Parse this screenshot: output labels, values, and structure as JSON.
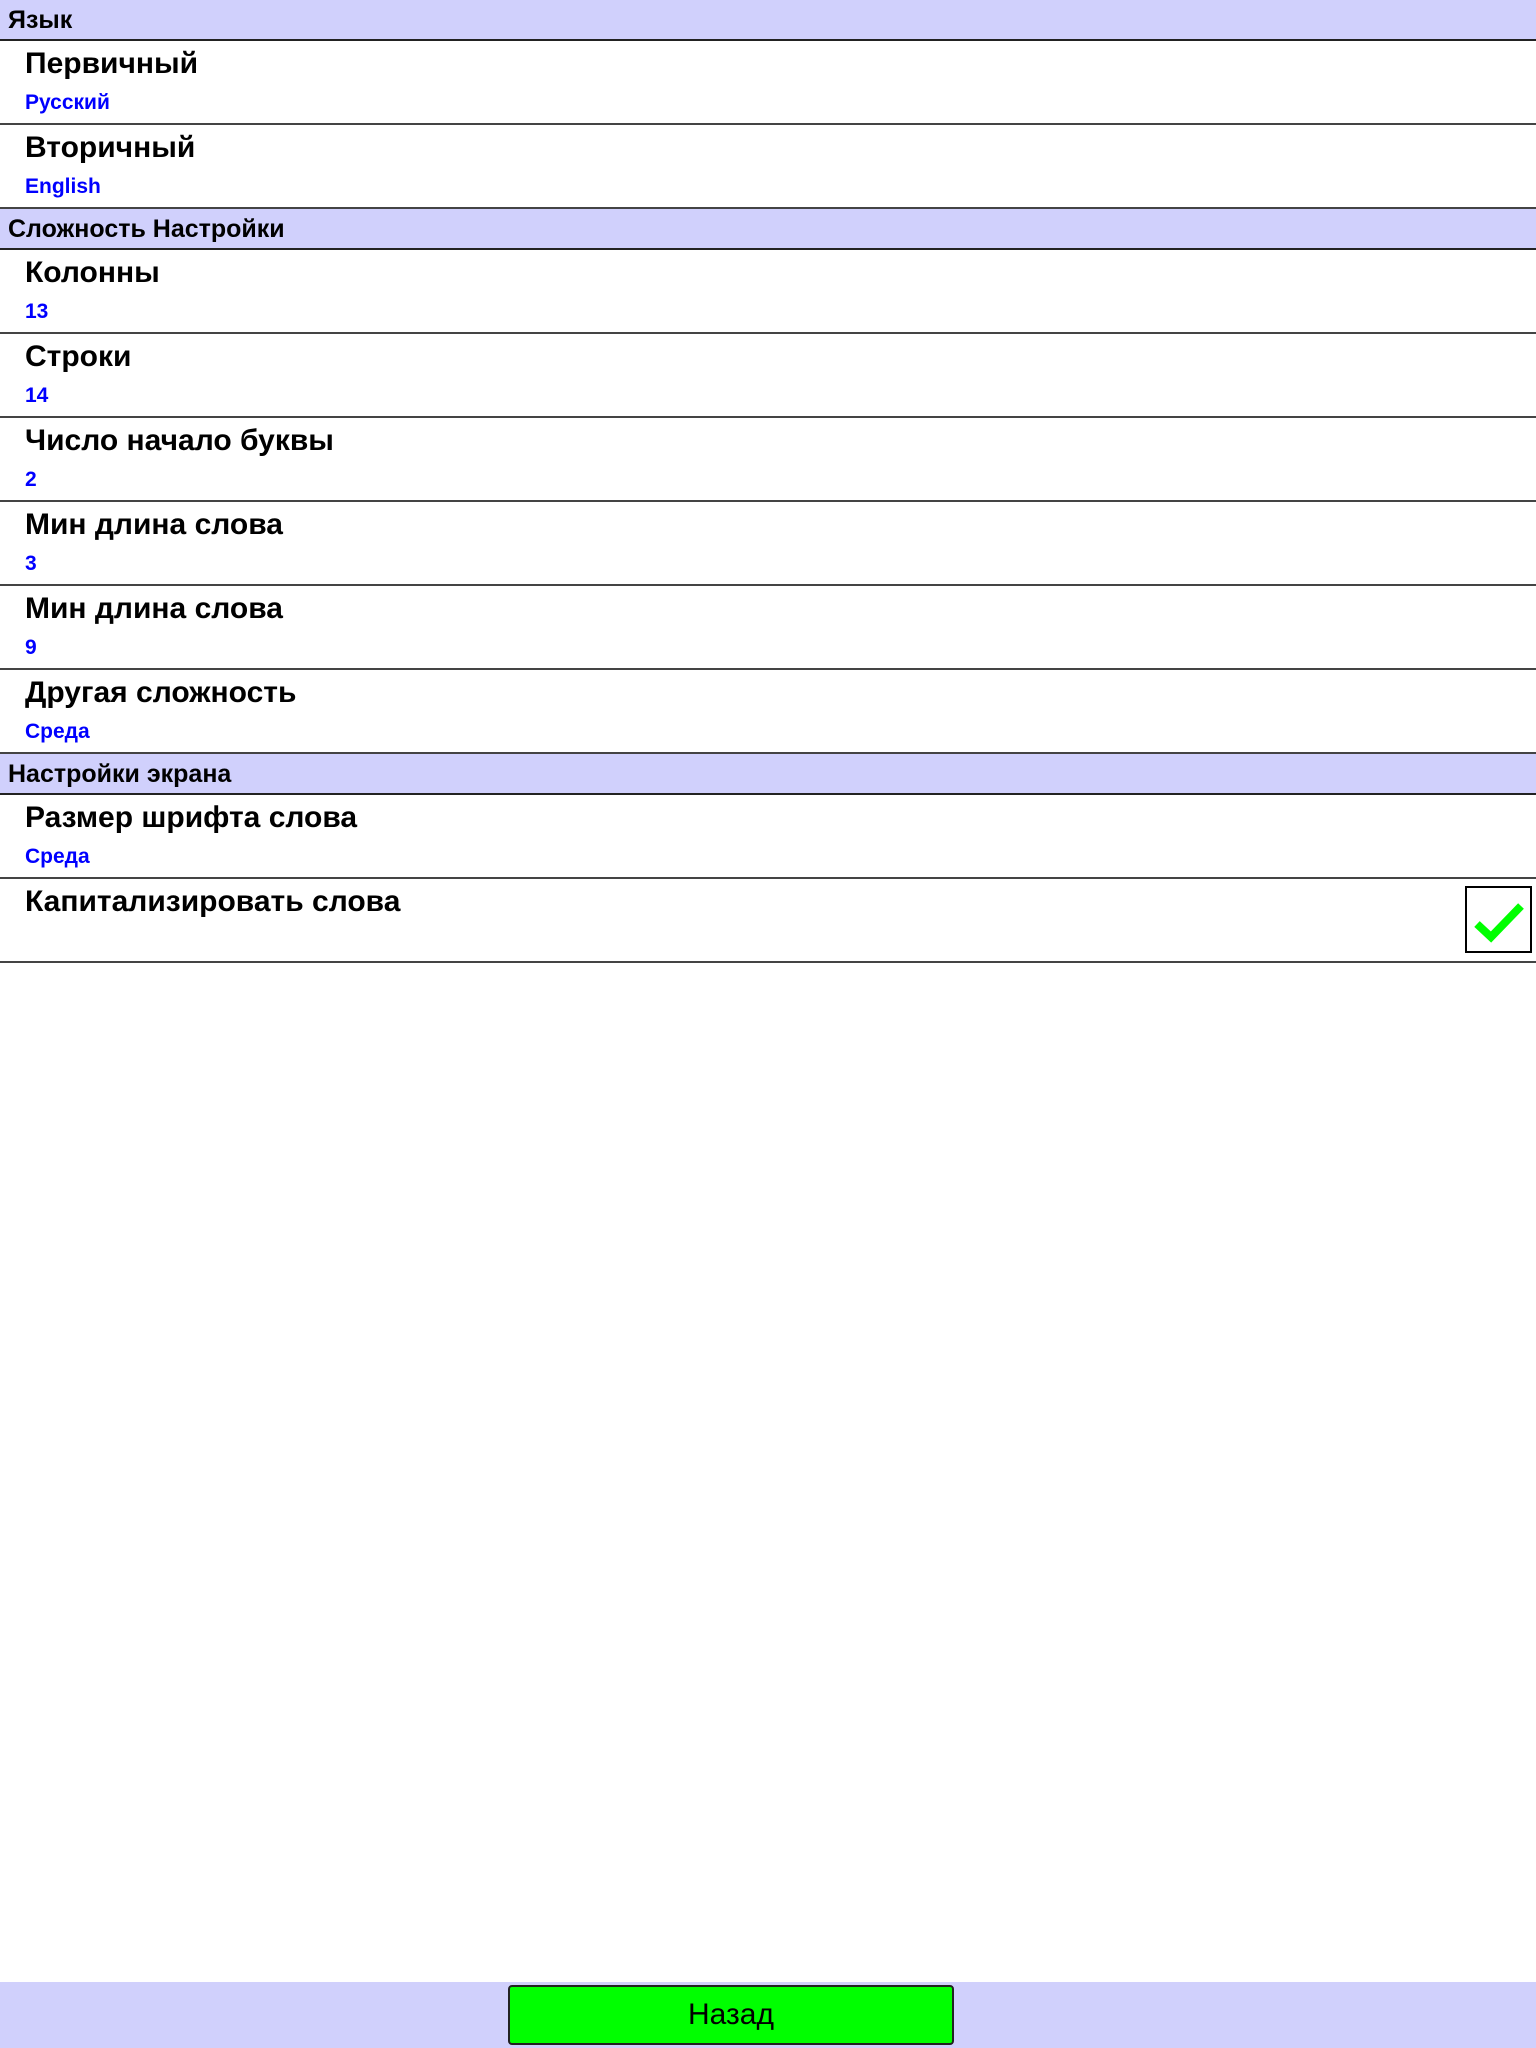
{
  "sections": [
    {
      "header": "Язык",
      "items": [
        {
          "title": "Первичный",
          "value": "Русский"
        },
        {
          "title": "Вторичный",
          "value": "English"
        }
      ]
    },
    {
      "header": "Сложность Настройки",
      "items": [
        {
          "title": "Колонны",
          "value": "13"
        },
        {
          "title": "Строки",
          "value": "14"
        },
        {
          "title": "Число начало буквы",
          "value": "2"
        },
        {
          "title": "Мин длина слова",
          "value": "3"
        },
        {
          "title": "Мин длина слова",
          "value": "9"
        },
        {
          "title": "Другая сложность",
          "value": "Среда"
        }
      ]
    },
    {
      "header": "Настройки экрана",
      "items": [
        {
          "title": "Размер шрифта слова",
          "value": "Среда"
        },
        {
          "title": "Капитализировать слова",
          "checked": true
        }
      ]
    }
  ],
  "back_label": "Назад",
  "colors": {
    "header_bg": "#d0d0fc",
    "value": "#0000ff",
    "check": "#00ff00",
    "back_button": "#00ff00"
  }
}
